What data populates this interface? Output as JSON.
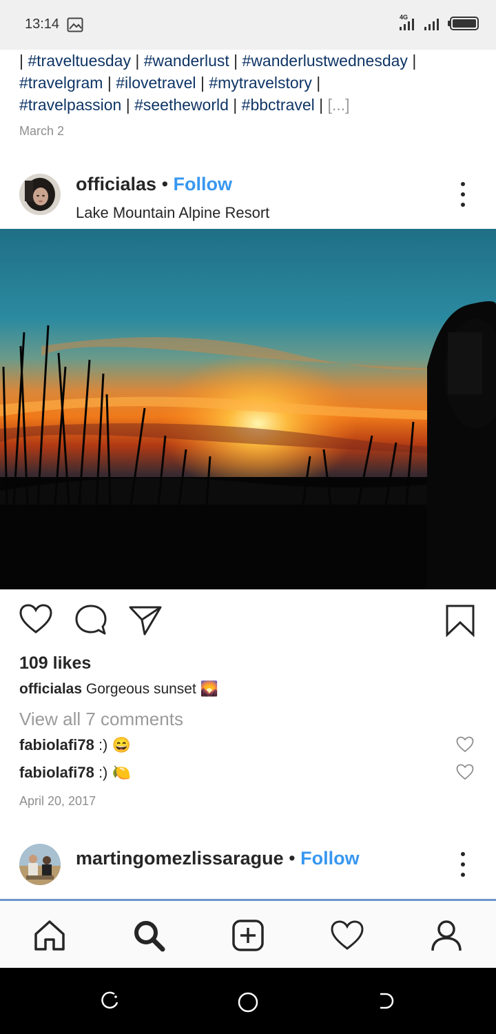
{
  "status_bar": {
    "time": "13:14",
    "network": "4G"
  },
  "top_post": {
    "hashtags": [
      {
        "text": "#traveltuesday"
      },
      {
        "text": "#wanderlust"
      },
      {
        "text": "#wanderlustwednesday"
      },
      {
        "text": "#travelgram"
      },
      {
        "text": "#ilovetravel"
      },
      {
        "text": "#mytravelstory"
      },
      {
        "text": "#travelpassion"
      },
      {
        "text": "#seetheworld"
      },
      {
        "text": "#bbctravel"
      }
    ],
    "separator": "|",
    "more": "[...]",
    "date": "March 2"
  },
  "post": {
    "username": "officialas",
    "dot": "•",
    "follow": "Follow",
    "location": "Lake Mountain Alpine Resort",
    "likes": "109 likes",
    "caption_user": "officialas",
    "caption_text": "Gorgeous sunset 🌄",
    "view_all": "View all 7 comments",
    "comments": [
      {
        "user": "fabiolafi78",
        "text": ":) 😄"
      },
      {
        "user": "fabiolafi78",
        "text": ":) 🍋"
      }
    ],
    "date": "April 20, 2017"
  },
  "next_post": {
    "username": "martingomezlissarague",
    "dot": "•",
    "follow": "Follow"
  },
  "colors": {
    "link": "#0f3566",
    "follow": "#3897f0",
    "muted": "#8e8e8e"
  }
}
